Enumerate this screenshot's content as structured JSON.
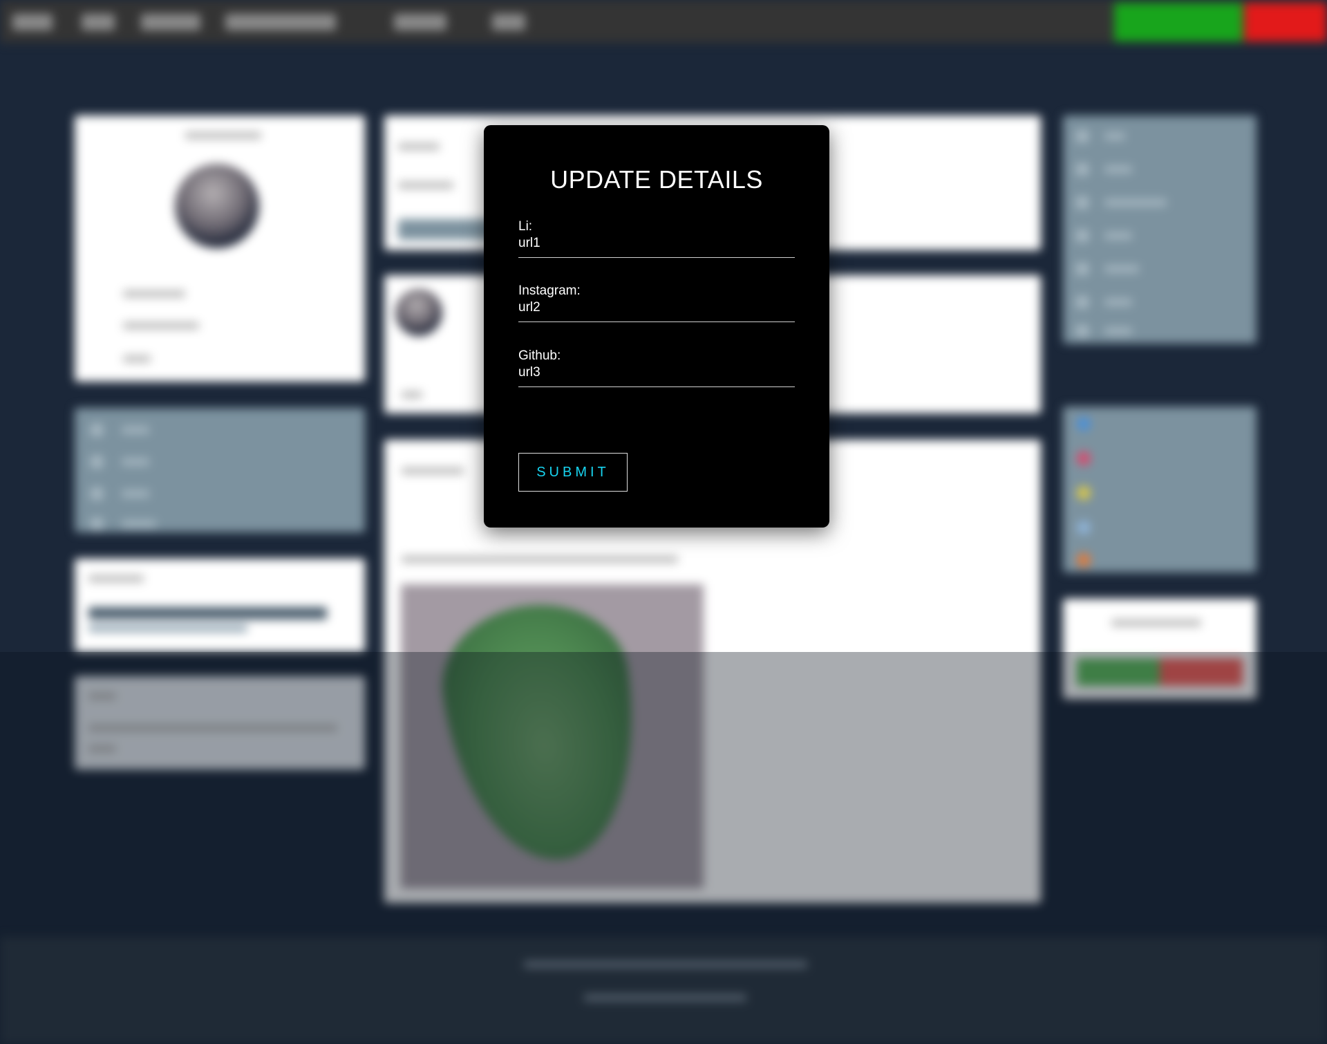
{
  "modal": {
    "title": "UPDATE DETAILS",
    "fields": [
      {
        "label": "Li:",
        "value": "url1"
      },
      {
        "label": "Instagram:",
        "value": "url2"
      },
      {
        "label": "Github:",
        "value": "url3"
      }
    ],
    "submit_label": "SUBMIT"
  },
  "colors": {
    "page_background": "#1b2739",
    "navbar": "#343434",
    "green_button": "#18a51c",
    "red_button": "#e21a1a",
    "modal_background": "#000000",
    "submit_text": "#18d4f0"
  }
}
